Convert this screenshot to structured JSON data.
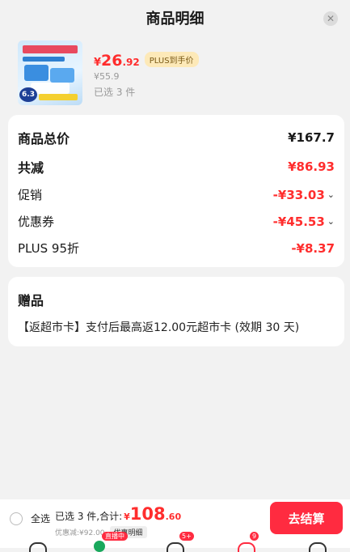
{
  "header": {
    "title": "商品明细"
  },
  "product": {
    "price_symbol": "¥",
    "price_int": "26",
    "price_dec": ".92",
    "plus_tag": "PLUS到手价",
    "original_price": "¥55.9",
    "selected": "已选 3 件",
    "thumb_badge": "6.3"
  },
  "summary": {
    "rows": [
      {
        "label": "商品总价",
        "value": "¥167.7"
      },
      {
        "label": "共减",
        "value": "¥86.93"
      },
      {
        "label": "促销",
        "value": "-¥33.03"
      },
      {
        "label": "优惠券",
        "value": "-¥45.53"
      },
      {
        "label": "PLUS 95折",
        "value": "-¥8.37"
      }
    ]
  },
  "gift": {
    "title": "赠品",
    "description": "【返超市卡】支付后最高返12.00元超市卡 (效期 30 天)"
  },
  "footer": {
    "select_all": "全选",
    "total_text": "已选 3 件,合计:",
    "total_symbol": "¥",
    "total_int": "108",
    "total_dec": ".60",
    "discount_text": "优惠减:¥92.00",
    "detail_label": "优惠明细",
    "checkout_label": "去结算"
  },
  "tabbar": {
    "live_badge": "直播中",
    "message_badge": "5+",
    "cart_badge": "9"
  },
  "colors": {
    "accent": "#ff2b40",
    "price_red": "#ff2d2d",
    "plus_bg": "#fde9b8"
  }
}
